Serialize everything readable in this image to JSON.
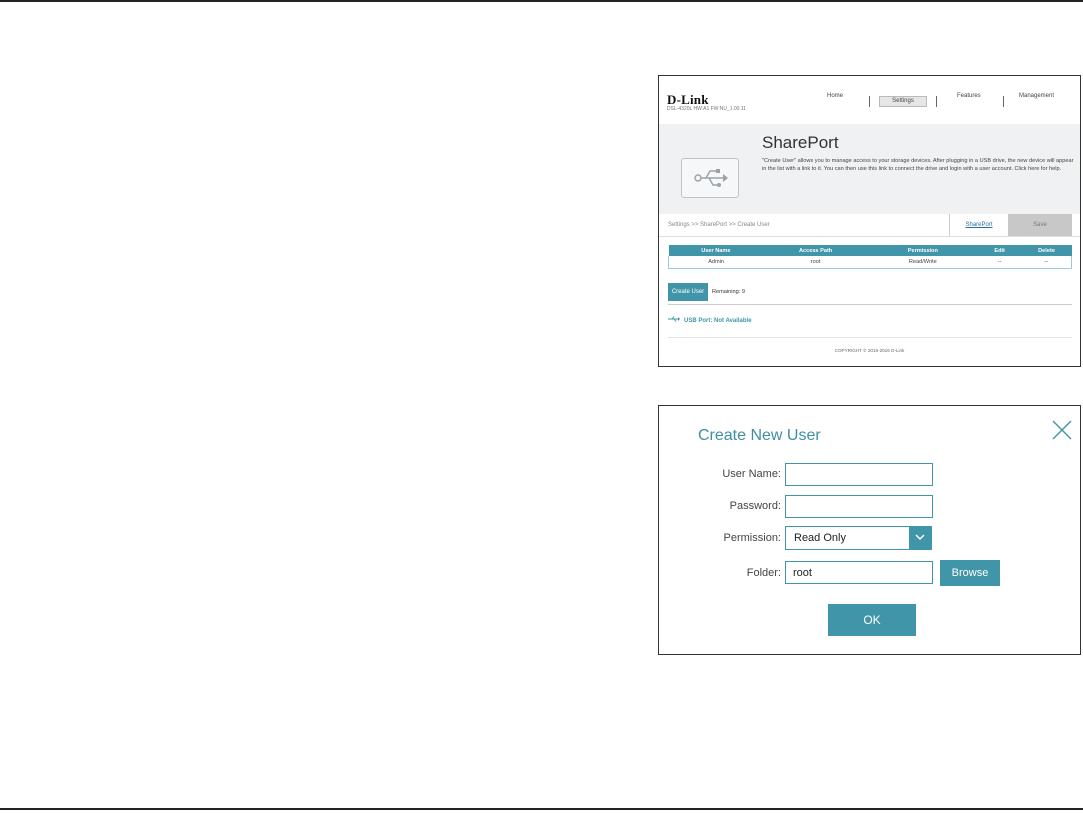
{
  "shareport_page": {
    "brand": "D-Link",
    "firmware_line": "DSL-4320L   HW:A1   FW:NU_1.00.11",
    "nav": {
      "home": "Home",
      "settings": "Settings",
      "features": "Features",
      "management": "Management",
      "active": "Settings"
    },
    "title": "SharePort",
    "description": "\"Create User\" allows you to manage access to your storage devices. After plugging in a USB drive, the new device will appear in the list with a link to it. You can then use this link to connect the drive and login with a user account. Click here for help.",
    "breadcrumb": "Settings >> SharePort >> Create User",
    "shareport_link": "SharePort",
    "save_label": "Save",
    "table": {
      "headers": [
        "User Name",
        "Access Path",
        "Permission",
        "Edit",
        "Delete"
      ],
      "rows": [
        [
          "Admin",
          "root",
          "Read/Write",
          "--",
          "--"
        ]
      ]
    },
    "create_user_label": "Create User",
    "remaining": "Remaining: 9",
    "usb_port": "USB Port: Not Available",
    "copyright": "COPYRIGHT © 2015-2016 D-Link",
    "colors": {
      "accent": "#4195a8",
      "hero_bg": "#f0f1f2"
    }
  },
  "create_user_dialog": {
    "title": "Create New User",
    "fields": {
      "user_name_label": "User Name:",
      "user_name_value": "",
      "password_label": "Password:",
      "password_value": "",
      "permission_label": "Permission:",
      "permission_value": "Read Only",
      "folder_label": "Folder:",
      "folder_value": "root"
    },
    "browse_label": "Browse",
    "ok_label": "OK",
    "icons": {
      "close": "close-icon",
      "dropdown": "chevron-down-icon"
    }
  }
}
